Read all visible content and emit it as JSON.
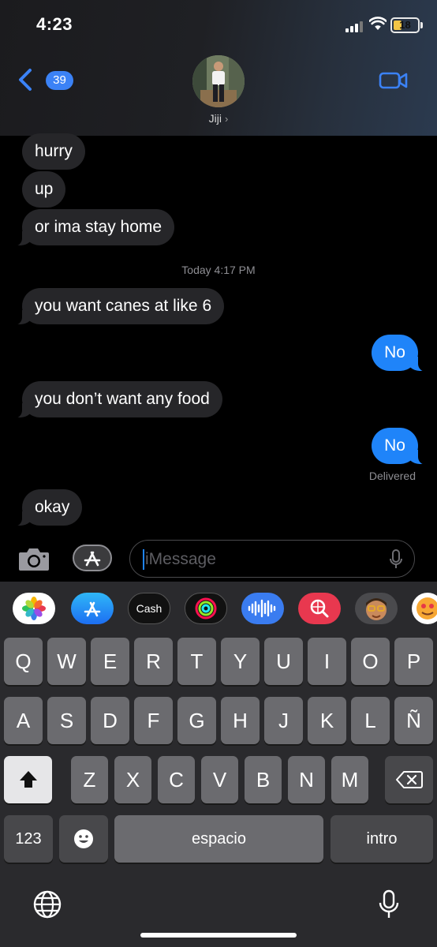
{
  "status_bar": {
    "time": "4:23",
    "battery_level": "18"
  },
  "header": {
    "back_badge": "39",
    "contact_name": "Jiji",
    "contact_chevron": "›"
  },
  "messages": [
    {
      "text": "hurry",
      "direction": "incoming"
    },
    {
      "text": "up",
      "direction": "incoming"
    },
    {
      "text": "or ima stay home",
      "direction": "incoming"
    },
    {
      "text": "you want canes at like 6",
      "direction": "incoming"
    },
    {
      "text": "No",
      "direction": "outgoing"
    },
    {
      "text": "you don’t want any food",
      "direction": "incoming"
    },
    {
      "text": "No",
      "direction": "outgoing"
    },
    {
      "text": "okay",
      "direction": "incoming"
    }
  ],
  "timestamp": "Today 4:17 PM",
  "delivered_label": "Delivered",
  "input": {
    "placeholder": "iMessage"
  },
  "app_drawer": [
    {
      "name": "photos-app-icon"
    },
    {
      "name": "app-store-icon"
    },
    {
      "name": "apple-cash-icon",
      "label": "Cash"
    },
    {
      "name": "activity-icon"
    },
    {
      "name": "audio-message-icon"
    },
    {
      "name": "search-images-icon"
    },
    {
      "name": "memoji-icon"
    },
    {
      "name": "emoji-stickers-icon"
    }
  ],
  "keyboard": {
    "row1": [
      "Q",
      "W",
      "E",
      "R",
      "T",
      "Y",
      "U",
      "I",
      "O",
      "P"
    ],
    "row2": [
      "A",
      "S",
      "D",
      "F",
      "G",
      "H",
      "J",
      "K",
      "L",
      "Ñ"
    ],
    "row3": [
      "Z",
      "X",
      "C",
      "V",
      "B",
      "N",
      "M"
    ],
    "numbers_key": "123",
    "space_key": "espacio",
    "return_key": "intro"
  },
  "colors": {
    "outgoing_bubble": "#1f84f9",
    "incoming_bubble": "#262629",
    "accent": "#3b82f6",
    "battery": "#f3c546"
  }
}
